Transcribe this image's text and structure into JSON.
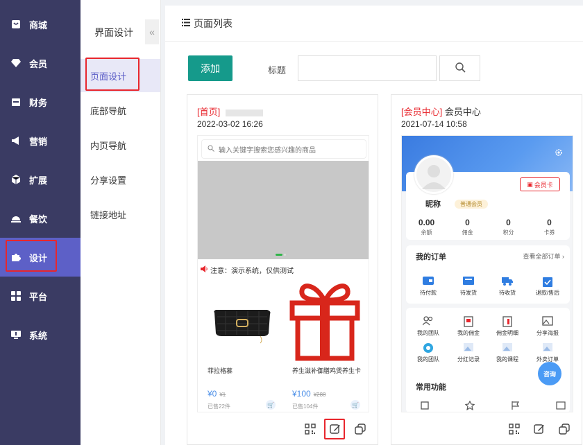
{
  "sidebar": {
    "items": [
      {
        "label": "商城",
        "icon": "shop-icon"
      },
      {
        "label": "会员",
        "icon": "diamond-icon"
      },
      {
        "label": "财务",
        "icon": "wallet-icon"
      },
      {
        "label": "营销",
        "icon": "megaphone-icon"
      },
      {
        "label": "扩展",
        "icon": "cube-icon"
      },
      {
        "label": "餐饮",
        "icon": "dish-icon"
      },
      {
        "label": "设计",
        "icon": "puzzle-icon"
      },
      {
        "label": "平台",
        "icon": "grid-icon"
      },
      {
        "label": "系统",
        "icon": "monitor-icon"
      }
    ],
    "active": "设计"
  },
  "submenu": {
    "title": "界面设计",
    "collapse_glyph": "«",
    "items": [
      "页面设计",
      "底部导航",
      "内页导航",
      "分享设置",
      "链接地址"
    ],
    "active": "页面设计"
  },
  "main": {
    "header": "页面列表",
    "add_label": "添加",
    "title_label": "标题",
    "title_value": "",
    "title_placeholder": ""
  },
  "cards": [
    {
      "tag": "[首页]",
      "name": "",
      "date": "2022-03-02 16:26",
      "preview": {
        "search_placeholder": "输入关键字搜索您感兴趣的商品",
        "notice": "注意：演示系统，仅供测试",
        "products": [
          {
            "name": "菲拉格慕",
            "price": "¥0",
            "old_price": "¥1",
            "sold": "已售22件"
          },
          {
            "name": "养生滋补御膳鸡煲养生卡",
            "price": "¥100",
            "old_price": "¥288",
            "sold": "已售104件"
          }
        ]
      }
    },
    {
      "tag": "[会员中心]",
      "name": "会员中心",
      "date": "2021-07-14 10:58",
      "preview": {
        "nickname": "昵称",
        "level": "普通会员",
        "vip_button": "会员卡",
        "stats": [
          {
            "value": "0.00",
            "label": "余额"
          },
          {
            "value": "0",
            "label": "佣金"
          },
          {
            "value": "0",
            "label": "积分"
          },
          {
            "value": "0",
            "label": "卡券"
          }
        ],
        "orders_title": "我的订单",
        "orders_more": "查看全部订单",
        "order_items": [
          "待付款",
          "待发货",
          "待收货",
          "退款/售后"
        ],
        "tool_items": [
          "我的团队",
          "我的佣金",
          "佣金明细",
          "分享海报",
          "我的团队",
          "分红记录",
          "我的课程",
          "外卖订单"
        ],
        "common_title": "常用功能",
        "float_button": "咨询"
      }
    }
  ],
  "colors": {
    "sidebar_bg": "#3a3b63",
    "sidebar_active": "#5d60c7",
    "add_button": "#159a8b",
    "highlight_red": "#e8262d",
    "member_blue": "#3a7be0"
  }
}
